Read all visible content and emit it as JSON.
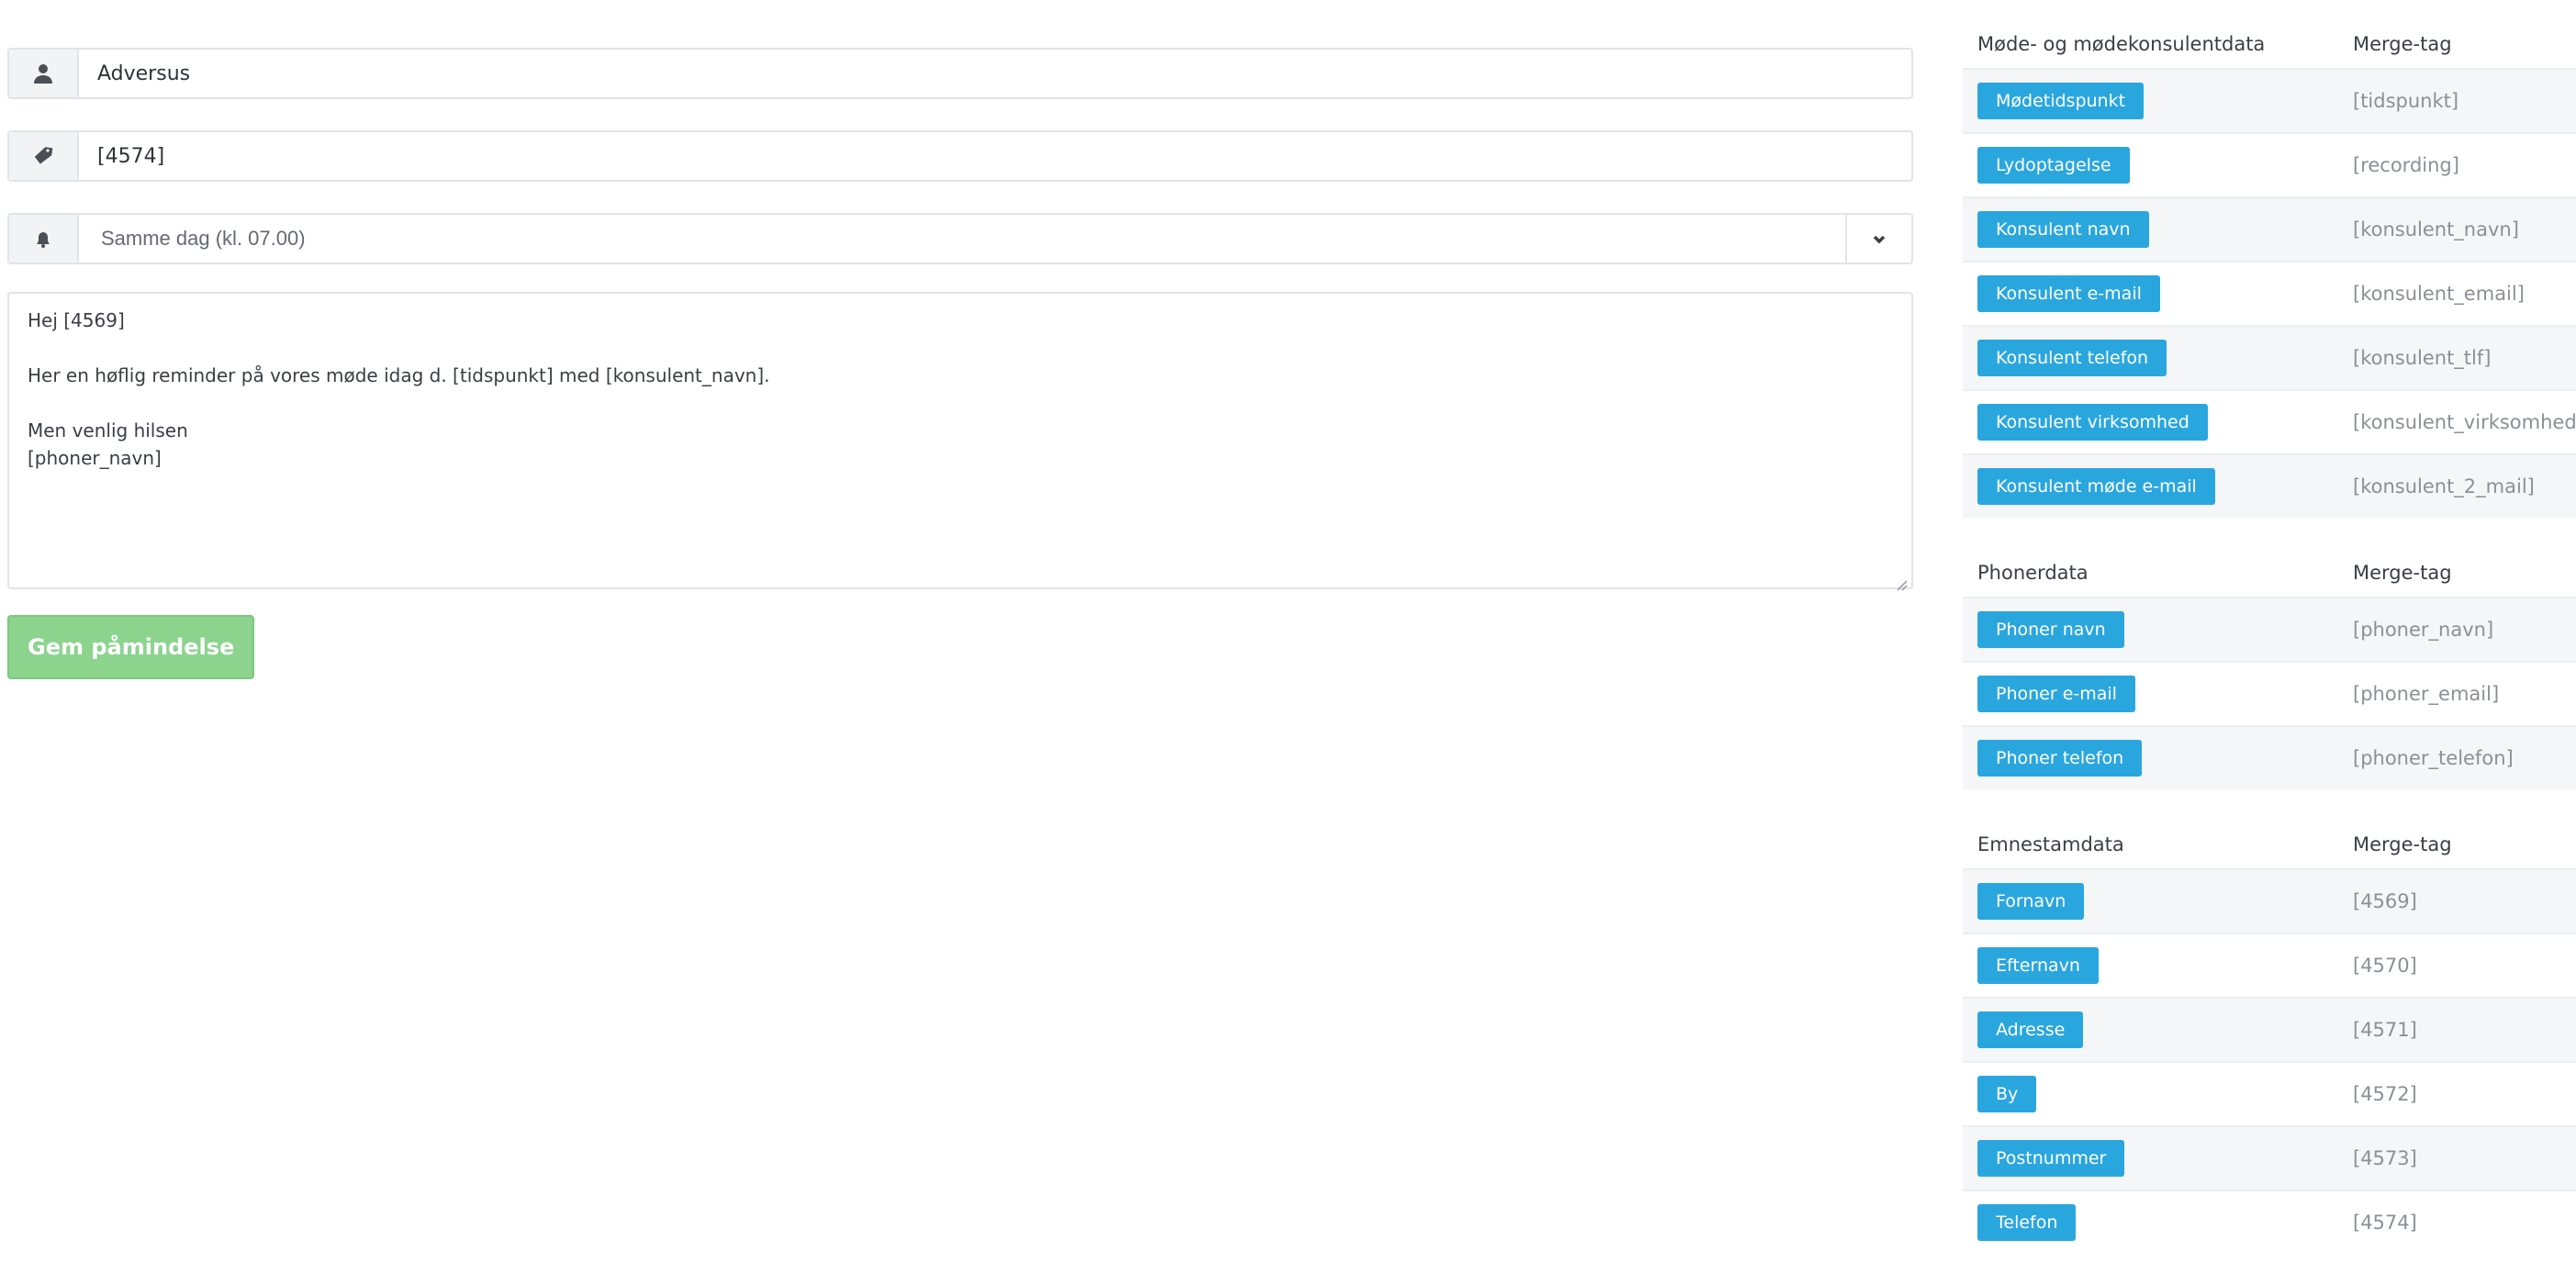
{
  "form": {
    "sender": {
      "icon": "user-icon",
      "value": "Adversus"
    },
    "phone": {
      "icon": "tag-icon",
      "value": "[4574]"
    },
    "timing": {
      "icon": "bell-icon",
      "selected": "Samme dag (kl. 07.00)"
    },
    "message": {
      "lines": [
        "Hej [4569]",
        "",
        "Her en høflig reminder på vores møde idag d. [tidspunkt] med [konsulent_navn].",
        "",
        "Men venlig hilsen",
        "[phoner_navn]"
      ]
    },
    "save_label": "Gem påmindelse"
  },
  "tables": [
    {
      "header": "Møde- og mødekonsulentdata",
      "tag_header": "Merge-tag",
      "rows": [
        {
          "label": "Mødetidspunkt",
          "tag": "[tidspunkt]"
        },
        {
          "label": "Lydoptagelse",
          "tag": "[recording]"
        },
        {
          "label": "Konsulent navn",
          "tag": "[konsulent_navn]"
        },
        {
          "label": "Konsulent e-mail",
          "tag": "[konsulent_email]"
        },
        {
          "label": "Konsulent telefon",
          "tag": "[konsulent_tlf]"
        },
        {
          "label": "Konsulent virksomhed",
          "tag": "[konsulent_virksomhed]"
        },
        {
          "label": "Konsulent møde e-mail",
          "tag": "[konsulent_2_mail]"
        }
      ]
    },
    {
      "header": "Phonerdata",
      "tag_header": "Merge-tag",
      "rows": [
        {
          "label": "Phoner navn",
          "tag": "[phoner_navn]"
        },
        {
          "label": "Phoner e-mail",
          "tag": "[phoner_email]"
        },
        {
          "label": "Phoner telefon",
          "tag": "[phoner_telefon]"
        }
      ]
    },
    {
      "header": "Emnestamdata",
      "tag_header": "Merge-tag",
      "rows": [
        {
          "label": "Fornavn",
          "tag": "[4569]"
        },
        {
          "label": "Efternavn",
          "tag": "[4570]"
        },
        {
          "label": "Adresse",
          "tag": "[4571]"
        },
        {
          "label": "By",
          "tag": "[4572]"
        },
        {
          "label": "Postnummer",
          "tag": "[4573]"
        },
        {
          "label": "Telefon",
          "tag": "[4574]"
        }
      ]
    }
  ],
  "colors": {
    "tag_button": "#2aa6df",
    "save_button": "#8cd48e",
    "border": "#e1e4e8"
  }
}
